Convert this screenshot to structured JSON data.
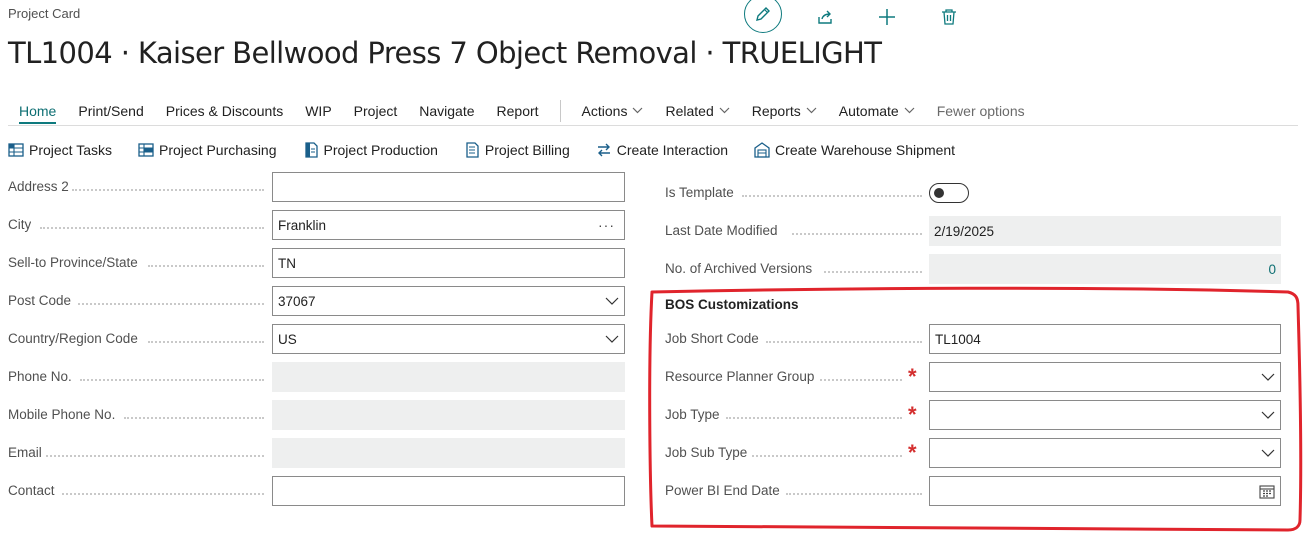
{
  "header": {
    "page_type": "Project Card",
    "title": "TL1004 · Kaiser Bellwood Press 7 Object Removal · TRUELIGHT"
  },
  "top_actions": [
    "edit-icon",
    "share-icon",
    "plus-icon",
    "delete-icon"
  ],
  "menu": {
    "items": [
      {
        "label": "Home",
        "active": true
      },
      {
        "label": "Print/Send"
      },
      {
        "label": "Prices & Discounts"
      },
      {
        "label": "WIP"
      },
      {
        "label": "Project"
      },
      {
        "label": "Navigate"
      },
      {
        "label": "Report"
      }
    ],
    "dropdowns": [
      {
        "label": "Actions"
      },
      {
        "label": "Related"
      },
      {
        "label": "Reports"
      },
      {
        "label": "Automate"
      }
    ],
    "fewer_options": "Fewer options"
  },
  "actions": [
    {
      "label": "Project Tasks",
      "icon": "grid-icon"
    },
    {
      "label": "Project Purchasing",
      "icon": "grid-icon"
    },
    {
      "label": "Project Production",
      "icon": "document-icon"
    },
    {
      "label": "Project Billing",
      "icon": "document-icon"
    },
    {
      "label": "Create Interaction",
      "icon": "arrows-icon"
    },
    {
      "label": "Create Warehouse Shipment",
      "icon": "warehouse-icon"
    }
  ],
  "left_fields": [
    {
      "label": "Address 2",
      "value": "",
      "type": "text"
    },
    {
      "label": "City",
      "value": "Franklin",
      "type": "lookup"
    },
    {
      "label": "Sell-to Province/State",
      "value": "TN",
      "type": "text"
    },
    {
      "label": "Post Code",
      "value": "37067",
      "type": "dropdown"
    },
    {
      "label": "Country/Region Code",
      "value": "US",
      "type": "dropdown"
    },
    {
      "label": "Phone No.",
      "value": "",
      "type": "readonly"
    },
    {
      "label": "Mobile Phone No.",
      "value": "",
      "type": "readonly"
    },
    {
      "label": "Email",
      "value": "",
      "type": "readonly"
    },
    {
      "label": "Contact",
      "value": "",
      "type": "text"
    }
  ],
  "right_fields": {
    "is_template": {
      "label": "Is Template",
      "on": false
    },
    "last_modified": {
      "label": "Last Date Modified",
      "value": "2/19/2025"
    },
    "archived_versions": {
      "label": "No. of Archived Versions",
      "value": "0"
    }
  },
  "bos": {
    "title": "BOS Customizations",
    "fields": [
      {
        "label": "Job Short Code",
        "value": "TL1004",
        "type": "text",
        "required": false
      },
      {
        "label": "Resource Planner Group",
        "value": "",
        "type": "dropdown",
        "required": true
      },
      {
        "label": "Job Type",
        "value": "",
        "type": "dropdown",
        "required": true
      },
      {
        "label": "Job Sub Type",
        "value": "",
        "type": "dropdown",
        "required": true
      },
      {
        "label": "Power BI End Date",
        "value": "",
        "type": "date",
        "required": false
      }
    ]
  },
  "colors": {
    "accent": "#0e7a7e",
    "required": "#d42f2f",
    "annotation": "#e0242c"
  }
}
